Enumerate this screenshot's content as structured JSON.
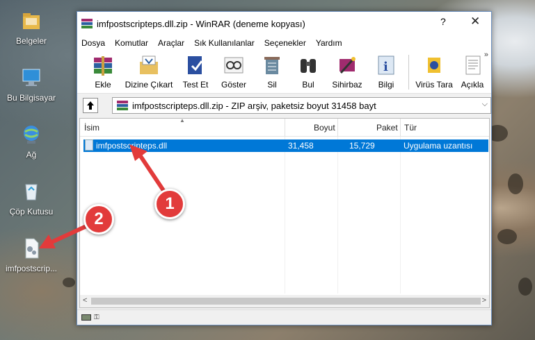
{
  "desktop": {
    "icons": [
      {
        "label": "Belgeler"
      },
      {
        "label": "Bu Bilgisayar"
      },
      {
        "label": "Ağ"
      },
      {
        "label": "Çöp Kutusu"
      },
      {
        "label": "imfpostscrip..."
      }
    ]
  },
  "window": {
    "title": "imfpostscripteps.dll.zip - WinRAR (deneme kopyası)",
    "help_label": "?",
    "close_label": "✕"
  },
  "menu": [
    "Dosya",
    "Komutlar",
    "Araçlar",
    "Sık Kullanılanlar",
    "Seçenekler",
    "Yardım"
  ],
  "toolbar": {
    "buttons": [
      "Ekle",
      "Dizine Çıkart",
      "Test Et",
      "Göster",
      "Sil",
      "Bul",
      "Sihirbaz",
      "Bilgi",
      "Virüs Tara",
      "Açıkla"
    ],
    "more": "»"
  },
  "address": {
    "text": "imfpostscripteps.dll.zip - ZIP arşiv, paketsiz boyut 31458 bayt",
    "dropdown": "⌵"
  },
  "file_list": {
    "headers": {
      "name": "İsim",
      "size": "Boyut",
      "packed": "Paket",
      "type": "Tür"
    },
    "rows": [
      {
        "name": "imfpostscripteps.dll",
        "size": "31,458",
        "packed": "15,729",
        "type": "Uygulama uzantısı"
      }
    ]
  },
  "scroll": {
    "left": "<",
    "right": ">"
  },
  "callouts": {
    "one": "1",
    "two": "2"
  },
  "colors": {
    "selection": "#0078d7",
    "callout": "#e23b3b"
  }
}
